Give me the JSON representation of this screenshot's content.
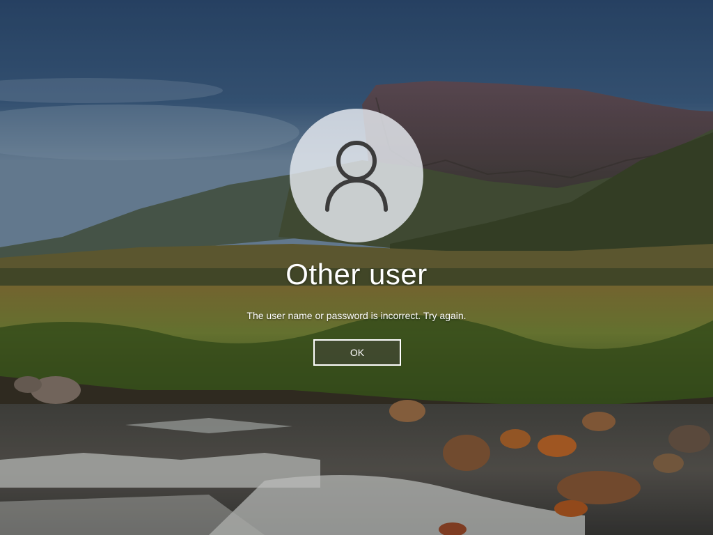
{
  "lock_screen": {
    "user_name": "Other user",
    "error_message": "The user name or password is incorrect. Try again.",
    "ok_label": "OK",
    "avatar_icon": "user-silhouette-icon"
  },
  "colors": {
    "sky_top": "#35567f",
    "sky_bottom": "#6f8fae",
    "avatar_bg": "#e8ecf2",
    "avatar_icon": "#3c3c3c",
    "button_border": "#ffffff"
  }
}
